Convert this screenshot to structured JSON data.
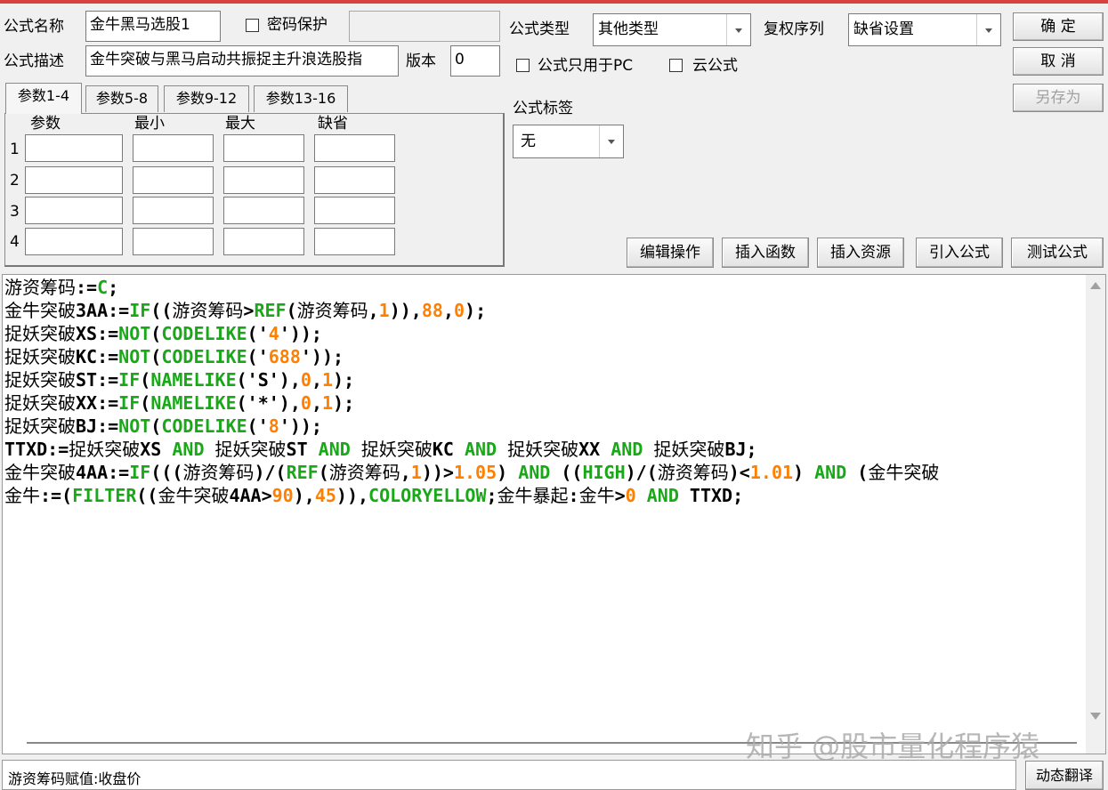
{
  "form": {
    "name_label": "公式名称",
    "name_value": "金牛黑马选股1",
    "password_label": "密码保护",
    "desc_label": "公式描述",
    "desc_value": "金牛突破与黑马启动共振捉主升浪选股指",
    "version_label": "版本",
    "version_value": "0",
    "type_label": "公式类型",
    "type_value": "其他类型",
    "rights_label": "复权序列",
    "rights_value": "缺省设置",
    "pc_only_label": "公式只用于PC",
    "cloud_label": "云公式",
    "tag_label": "公式标签",
    "tag_value": "无"
  },
  "buttons": {
    "ok": "确  定",
    "cancel": "取  消",
    "save_as": "另存为",
    "edit_ops": "编辑操作",
    "insert_func": "插入函数",
    "insert_res": "插入资源",
    "import_formula": "引入公式",
    "test_formula": "测试公式",
    "dyn_translate": "动态翻译"
  },
  "param_tabs": [
    "参数1-4",
    "参数5-8",
    "参数9-12",
    "参数13-16"
  ],
  "param_headers": [
    "参数",
    "最小",
    "最大",
    "缺省"
  ],
  "param_rows": [
    "1",
    "2",
    "3",
    "4"
  ],
  "status_text": "游资筹码赋值:收盘价",
  "watermark": "知乎 @股市量化程序猿",
  "colors": {
    "keyword": "#18a818",
    "number": "#ff8000",
    "accent_bar": "#d94040"
  }
}
